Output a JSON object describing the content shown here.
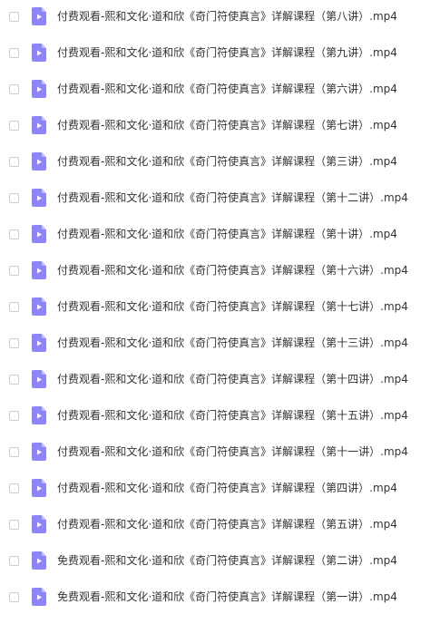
{
  "files": [
    {
      "name": "付费观看-熙和文化·道和欣《奇门符使真言》详解课程（第八讲）.mp4",
      "icon": "video-file-icon",
      "checked": false
    },
    {
      "name": "付费观看-熙和文化·道和欣《奇门符使真言》详解课程（第九讲）.mp4",
      "icon": "video-file-icon",
      "checked": false
    },
    {
      "name": "付费观看-熙和文化·道和欣《奇门符使真言》详解课程（第六讲）.mp4",
      "icon": "video-file-icon",
      "checked": false
    },
    {
      "name": "付费观看-熙和文化·道和欣《奇门符使真言》详解课程（第七讲）.mp4",
      "icon": "video-file-icon",
      "checked": false
    },
    {
      "name": "付费观看-熙和文化·道和欣《奇门符使真言》详解课程（第三讲）.mp4",
      "icon": "video-file-icon",
      "checked": false
    },
    {
      "name": "付费观看-熙和文化·道和欣《奇门符使真言》详解课程（第十二讲）.mp4",
      "icon": "video-file-icon",
      "checked": false
    },
    {
      "name": "付费观看-熙和文化·道和欣《奇门符使真言》详解课程（第十讲）.mp4",
      "icon": "video-file-icon",
      "checked": false
    },
    {
      "name": "付费观看-熙和文化·道和欣《奇门符使真言》详解课程（第十六讲）.mp4",
      "icon": "video-file-icon",
      "checked": false
    },
    {
      "name": "付费观看-熙和文化·道和欣《奇门符使真言》详解课程（第十七讲）.mp4",
      "icon": "video-file-icon",
      "checked": false
    },
    {
      "name": "付费观看-熙和文化·道和欣《奇门符使真言》详解课程（第十三讲）.mp4",
      "icon": "video-file-icon",
      "checked": false
    },
    {
      "name": "付费观看-熙和文化·道和欣《奇门符使真言》详解课程（第十四讲）.mp4",
      "icon": "video-file-icon",
      "checked": false
    },
    {
      "name": "付费观看-熙和文化·道和欣《奇门符使真言》详解课程（第十五讲）.mp4",
      "icon": "video-file-icon",
      "checked": false
    },
    {
      "name": "付费观看-熙和文化·道和欣《奇门符使真言》详解课程（第十一讲）.mp4",
      "icon": "video-file-icon",
      "checked": false
    },
    {
      "name": "付费观看-熙和文化·道和欣《奇门符使真言》详解课程（第四讲）.mp4",
      "icon": "video-file-icon",
      "checked": false
    },
    {
      "name": "付费观看-熙和文化·道和欣《奇门符使真言》详解课程（第五讲）.mp4",
      "icon": "video-file-icon",
      "checked": false
    },
    {
      "name": "免费观看-熙和文化·道和欣《奇门符使真言》详解课程（第二讲）.mp4",
      "icon": "video-file-icon",
      "checked": false
    },
    {
      "name": "免费观看-熙和文化·道和欣《奇门符使真言》详解课程（第一讲）.mp4",
      "icon": "video-file-icon",
      "checked": false
    }
  ],
  "colors": {
    "icon_fill": "#8d85f5",
    "icon_fold": "#c3beff",
    "icon_play": "#ffffff",
    "text": "#333333",
    "checkbox_border": "#c9ced8"
  }
}
